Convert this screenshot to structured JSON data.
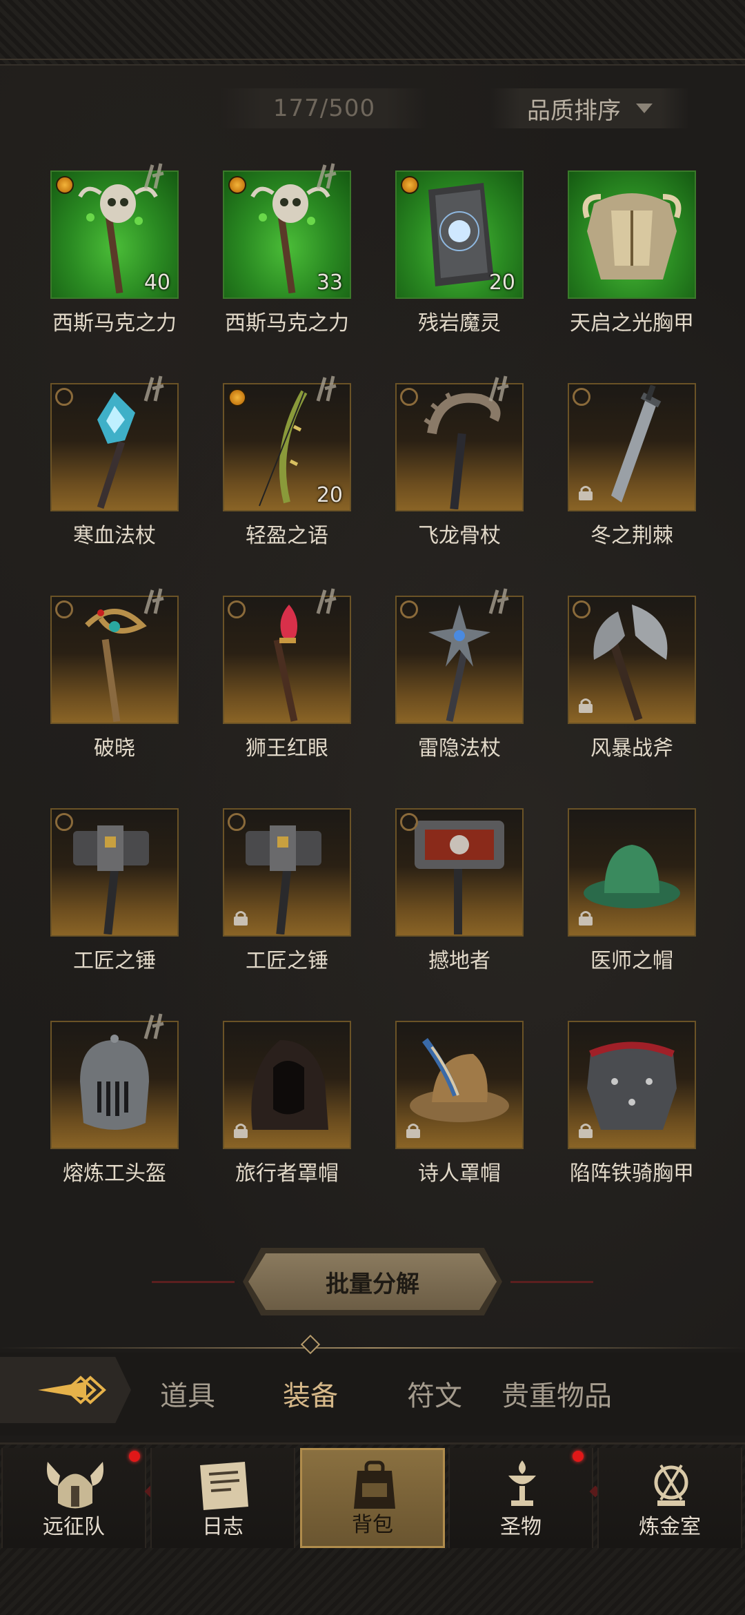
{
  "header": {
    "capacity": "177/500",
    "sort_label": "品质排序"
  },
  "items": [
    {
      "name": "西斯马克之力",
      "bg": "green",
      "badge": "gold",
      "forge": true,
      "count": "40",
      "locked": false,
      "icon": "skull-staff-icon"
    },
    {
      "name": "西斯马克之力",
      "bg": "green",
      "badge": "gold",
      "forge": true,
      "count": "33",
      "locked": false,
      "icon": "skull-staff-icon"
    },
    {
      "name": "残岩魔灵",
      "bg": "green",
      "badge": "gold",
      "forge": false,
      "count": "20",
      "locked": false,
      "icon": "stone-tome-icon"
    },
    {
      "name": "天启之光胸甲",
      "bg": "green",
      "badge": "none",
      "forge": false,
      "count": "",
      "locked": false,
      "icon": "gold-breastplate-icon"
    },
    {
      "name": "寒血法杖",
      "bg": "gold",
      "badge": "ring",
      "forge": true,
      "count": "",
      "locked": false,
      "icon": "ice-staff-icon"
    },
    {
      "name": "轻盈之语",
      "bg": "gold",
      "badge": "gold",
      "forge": true,
      "count": "20",
      "locked": false,
      "icon": "bow-icon"
    },
    {
      "name": "飞龙骨杖",
      "bg": "gold",
      "badge": "ring",
      "forge": true,
      "count": "",
      "locked": false,
      "icon": "bone-staff-icon"
    },
    {
      "name": "冬之荆棘",
      "bg": "gold",
      "badge": "ring",
      "forge": false,
      "count": "",
      "locked": true,
      "icon": "greatsword-icon"
    },
    {
      "name": "破晓",
      "bg": "gold",
      "badge": "ring",
      "forge": true,
      "count": "",
      "locked": false,
      "icon": "serpent-staff-icon"
    },
    {
      "name": "狮王红眼",
      "bg": "gold",
      "badge": "ring",
      "forge": true,
      "count": "",
      "locked": false,
      "icon": "ruby-wand-icon"
    },
    {
      "name": "雷隐法杖",
      "bg": "gold",
      "badge": "ring",
      "forge": true,
      "count": "",
      "locked": false,
      "icon": "star-staff-icon"
    },
    {
      "name": "风暴战斧",
      "bg": "gold",
      "badge": "ring",
      "forge": false,
      "count": "",
      "locked": true,
      "icon": "battle-axe-icon"
    },
    {
      "name": "工匠之锤",
      "bg": "gold",
      "badge": "ring",
      "forge": false,
      "count": "",
      "locked": false,
      "icon": "hammer-icon"
    },
    {
      "name": "工匠之锤",
      "bg": "gold",
      "badge": "ring",
      "forge": false,
      "count": "",
      "locked": true,
      "icon": "hammer-icon"
    },
    {
      "name": "撼地者",
      "bg": "gold",
      "badge": "ring",
      "forge": false,
      "count": "",
      "locked": false,
      "icon": "warhammer-icon"
    },
    {
      "name": "医师之帽",
      "bg": "gold",
      "badge": "none",
      "forge": false,
      "count": "",
      "locked": true,
      "icon": "green-hat-icon"
    },
    {
      "name": "熔炼工头盔",
      "bg": "gold",
      "badge": "none",
      "forge": true,
      "count": "",
      "locked": false,
      "icon": "helmet-icon"
    },
    {
      "name": "旅行者罩帽",
      "bg": "gold",
      "badge": "none",
      "forge": false,
      "count": "",
      "locked": true,
      "icon": "hood-icon"
    },
    {
      "name": "诗人罩帽",
      "bg": "gold",
      "badge": "none",
      "forge": false,
      "count": "",
      "locked": true,
      "icon": "feather-hat-icon"
    },
    {
      "name": "陷阵铁骑胸甲",
      "bg": "gold",
      "badge": "none",
      "forge": false,
      "count": "",
      "locked": true,
      "icon": "iron-breastplate-icon"
    }
  ],
  "batch_button": "批量分解",
  "tabs": [
    {
      "label": "道具",
      "active": false
    },
    {
      "label": "装备",
      "active": true
    },
    {
      "label": "符文",
      "active": false
    },
    {
      "label": "贵重物品",
      "active": false
    }
  ],
  "nav": [
    {
      "label": "远征队",
      "icon": "viking-helmet-icon",
      "dot": true,
      "active": false
    },
    {
      "label": "日志",
      "icon": "scroll-icon",
      "dot": false,
      "active": false
    },
    {
      "label": "背包",
      "icon": "backpack-icon",
      "dot": false,
      "active": true
    },
    {
      "label": "圣物",
      "icon": "chalice-icon",
      "dot": true,
      "active": false
    },
    {
      "label": "炼金室",
      "icon": "alchemy-icon",
      "dot": false,
      "active": false
    }
  ],
  "colors": {
    "accent_gold": "#d6b889",
    "notification_red": "#e01818",
    "rare_green": "#2a8a22"
  }
}
